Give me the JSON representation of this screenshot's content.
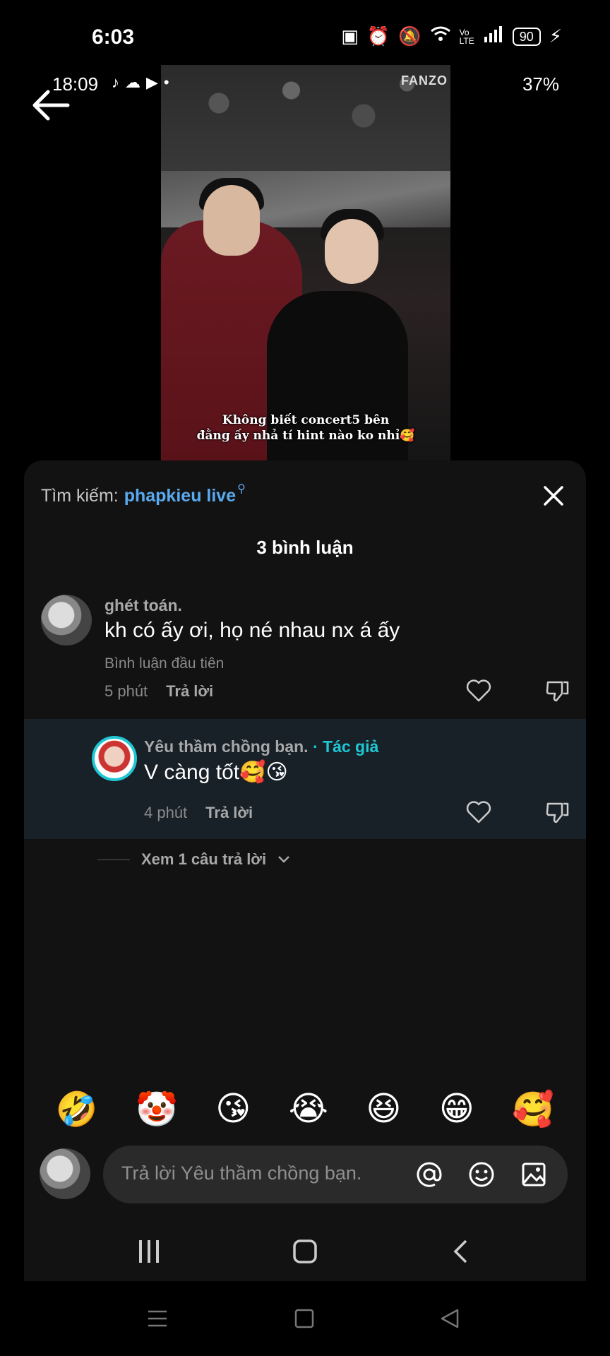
{
  "status_bar": {
    "time": "6:03",
    "battery": "90"
  },
  "inner_status_bar": {
    "time": "18:09",
    "battery": "37%"
  },
  "video": {
    "watermark": "FANZO",
    "caption_line1": "Không biết concert5 bên",
    "caption_line2": "đằng ấy nhả tí hint nào ko nhỉ🥰"
  },
  "search": {
    "label": "Tìm kiếm:",
    "term": "phapkieu live"
  },
  "comments_count": "3 bình luận",
  "comments": [
    {
      "author": "ghét toán.",
      "text": "kh có ấy ơi, họ né nhau nx á ấy",
      "note": "Bình luận đầu tiên",
      "time": "5 phút",
      "reply_label": "Trả lời"
    },
    {
      "author": "Yêu thầm chồng bạn.",
      "author_tag": "· Tác giả",
      "text": "V càng tốt🥰😘",
      "time": "4 phút",
      "reply_label": "Trả lời"
    }
  ],
  "more_replies": "Xem 1 câu trả lời",
  "emojis": [
    "🤣",
    "🤡",
    "😘",
    "😭",
    "😆",
    "😁",
    "🥰"
  ],
  "input": {
    "placeholder": "Trả lời Yêu thầm chồng bạn."
  },
  "colors": {
    "accent_blue": "#5aaaf0",
    "author_tag": "#1fc7d4",
    "sheet_bg": "#121212",
    "highlight_bg": "#182028"
  }
}
